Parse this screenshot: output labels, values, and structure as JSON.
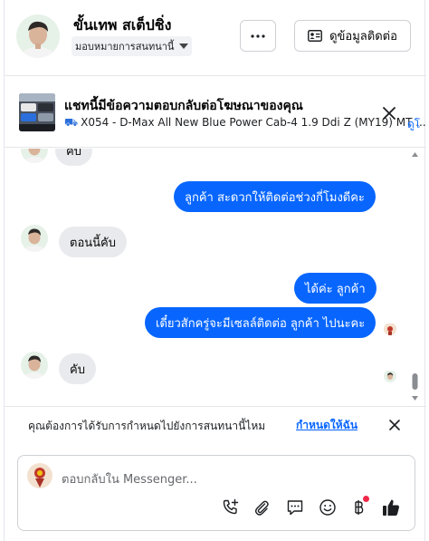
{
  "header": {
    "name": "ขั้นเทพ สเต็ปชิ่ง",
    "assign_label": "มอบหมายการสนทนานี้",
    "more_label": "···",
    "contact_label": "ดูข้อมูลติดต่อ"
  },
  "ad_banner": {
    "title": "แชทนี้มีข้อความตอบกลับต่อโฆษณาของคุณ",
    "subtitle": "X054 - D-Max All New Blue Power Cab-4 1.9 Ddi Z (MY19) MT ...",
    "link": "ดูโ"
  },
  "messages": [
    {
      "direction": "in",
      "text": "คับ"
    },
    {
      "direction": "out",
      "text": "ลูกค้า  สะดวกให้ติดต่อช่วงกี่โมงดีคะ"
    },
    {
      "direction": "in",
      "text": "ตอนนี้คับ"
    },
    {
      "direction": "out",
      "text": "ได้ค่ะ  ลูกค้า"
    },
    {
      "direction": "out",
      "text": "เดี๋ยวสักครู่จะมีเซลล์ติดต่อ ลูกค้า  ไปนะคะ"
    },
    {
      "direction": "in",
      "text": "คับ"
    }
  ],
  "suggestion": {
    "text": "คุณต้องการได้รับการกำหนดไปยังการสนทนานี้ไหม",
    "link": "กำหนดให้ฉัน"
  },
  "composer": {
    "placeholder": "ตอบกลับใน Messenger..."
  },
  "colors": {
    "accent": "#0866ff",
    "incoming_bubble": "#e9eaed",
    "notification_dot": "#f02849"
  }
}
